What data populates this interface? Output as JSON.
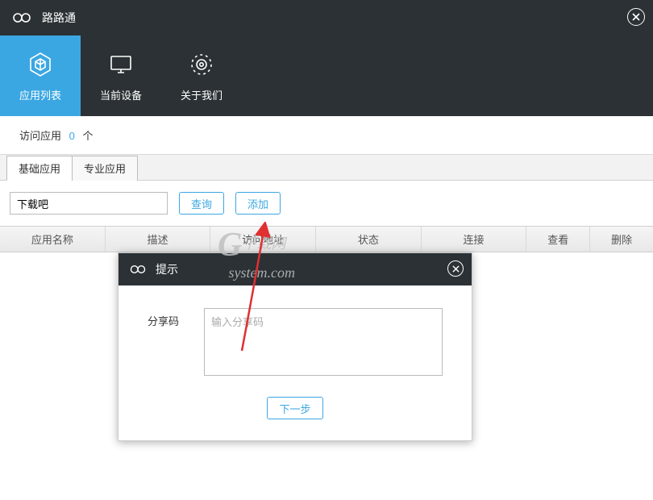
{
  "titlebar": {
    "title": "路路通"
  },
  "nav": {
    "items": [
      {
        "label": "应用列表"
      },
      {
        "label": "当前设备"
      },
      {
        "label": "关于我们"
      }
    ]
  },
  "summary": {
    "prefix": "访问应用",
    "count": "0",
    "suffix": "个"
  },
  "inner_tabs": [
    {
      "label": "基础应用"
    },
    {
      "label": "专业应用"
    }
  ],
  "toolbar": {
    "search_value": "下载吧",
    "query_label": "查询",
    "add_label": "添加"
  },
  "table": {
    "columns": [
      "应用名称",
      "描述",
      "访问地址",
      "状态",
      "连接",
      "查看",
      "删除"
    ]
  },
  "modal": {
    "title": "提示",
    "share_label": "分享码",
    "share_placeholder": "输入分享码",
    "next_label": "下一步"
  },
  "watermark": {
    "text1": "下载网",
    "text2": "system.com"
  }
}
